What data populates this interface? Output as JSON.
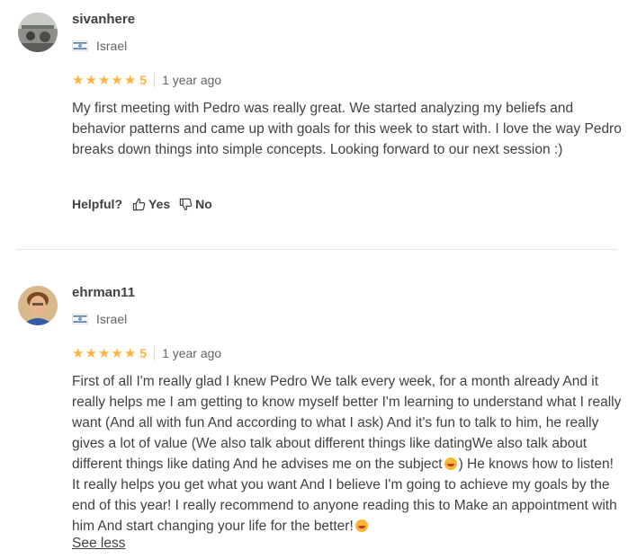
{
  "reviews": [
    {
      "username": "sivanhere",
      "country": "Israel",
      "score": "5",
      "date": "1 year ago",
      "text": "My first meeting with Pedro was really great. We started analyzing my beliefs and behavior patterns and came up with goals for this week to start with. I love the way Pedro breaks down things into simple concepts. Looking forward to our next session :)",
      "rating_value": 5,
      "helpful_label": "Helpful?",
      "yes_label": "Yes",
      "no_label": "No"
    },
    {
      "username": "ehrman11",
      "country": "Israel",
      "score": "5",
      "date": "1 year ago",
      "rating_value": 5,
      "text_part1": "First of all I'm really glad I knew Pedro We talk every week, for a month already And it really helps me I am getting to know myself better I'm learning to understand what I really want (And all with fun And according to what I ask) And it's fun to talk to him, he really gives a lot of value (We also talk about different things like datingWe also talk about different things like dating And he advises me on the subject",
      "text_part2": ") He knows how to listen! It really helps you get what you want And I believe I'm going to achieve my goals by the end of this year! I really recommend to anyone reading this to Make an appointment with him And start changing your life for the better!",
      "see_less": "See less"
    }
  ],
  "colors": {
    "star": "#ffb33e",
    "text": "#404145",
    "muted": "#62646a"
  },
  "icons": {
    "star": "star-icon",
    "thumbs_up": "thumbs-up-icon",
    "thumbs_down": "thumbs-down-icon",
    "flag": "israel-flag-icon",
    "emoji": "grinning-face-emoji-icon"
  }
}
